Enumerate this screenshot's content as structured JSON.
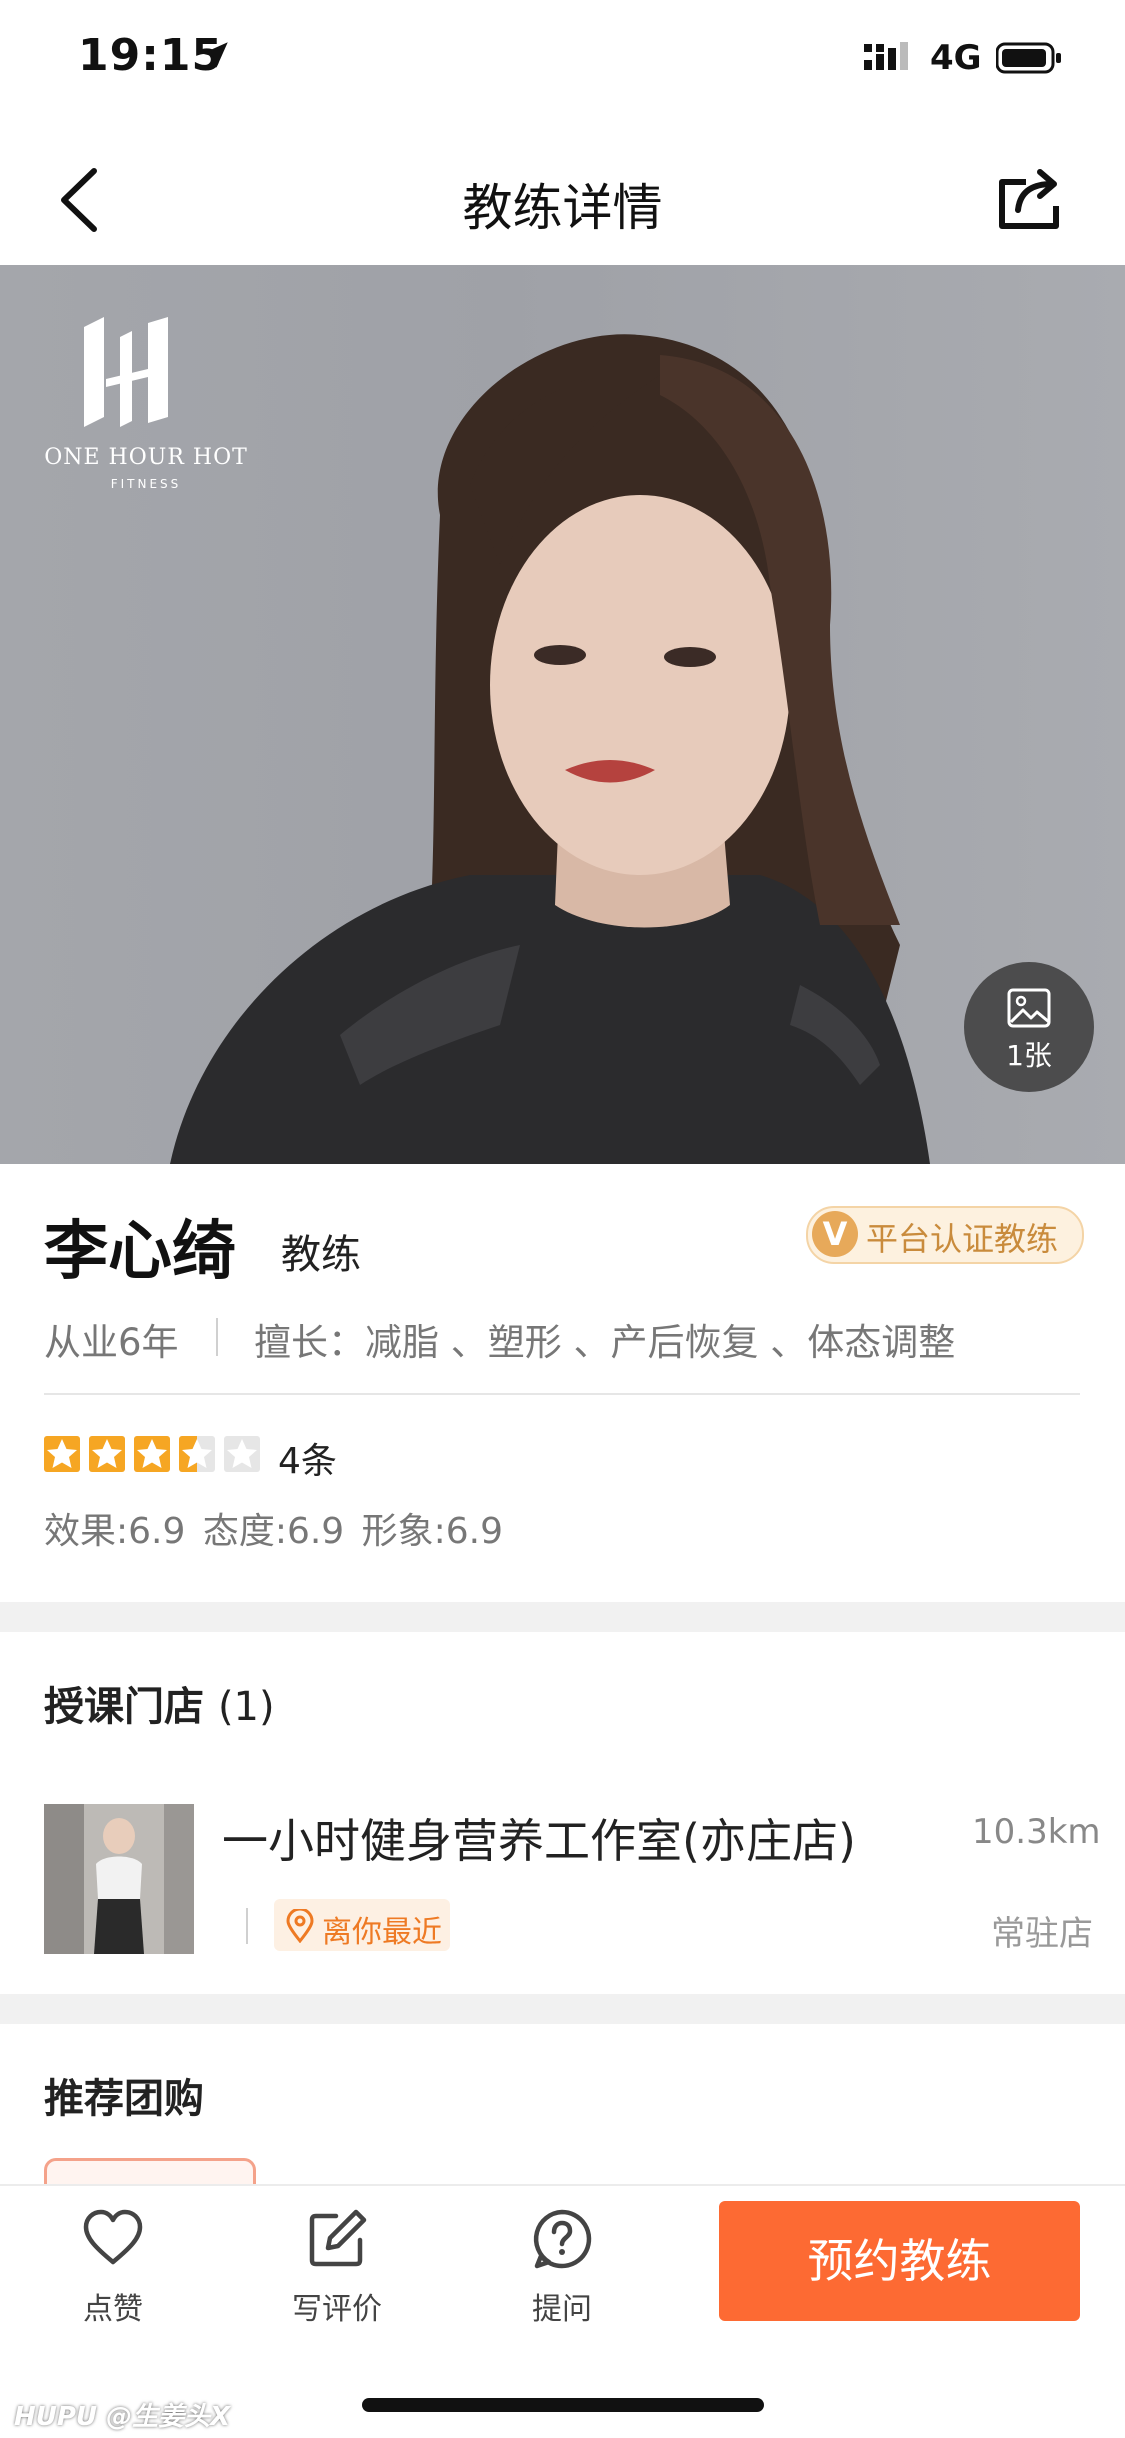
{
  "status_bar": {
    "time": "19:15",
    "network": "4G"
  },
  "nav": {
    "title": "教练详情"
  },
  "hero": {
    "brand_line1": "ONE HOUR HOT",
    "brand_line2": "FITNESS",
    "photo_count_label": "1张"
  },
  "coach": {
    "name": "李心绮",
    "role": "教练",
    "verified_badge_letter": "V",
    "verified_label": "平台认证教练",
    "experience": "从业6年",
    "skills": "擅长：减脂 、塑形 、产后恢复 、体态调整",
    "rating_stars": 3.5,
    "rating_max": 5,
    "review_count": "4条",
    "scores": "效果:6.9  态度:6.9  形象:6.9"
  },
  "stores_section": {
    "title": "授课门店",
    "count": "(1)",
    "store": {
      "name": "一小时健身营养工作室(亦庄店)",
      "distance": "10.3km",
      "tag": "离你最近",
      "type": "常驻店"
    }
  },
  "group_section": {
    "title": "推荐团购"
  },
  "bottom_bar": {
    "like_label": "点赞",
    "review_label": "写评价",
    "ask_label": "提问",
    "book_label": "预约教练"
  },
  "watermark": "HUPU @生姜头X",
  "colors": {
    "accent": "#fd6a33",
    "star": "#f6a623",
    "gold": "#c98b3c"
  }
}
